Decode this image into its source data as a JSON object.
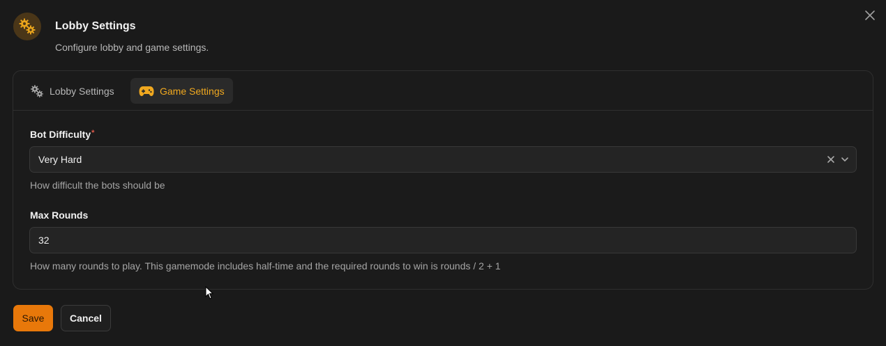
{
  "header": {
    "title": "Lobby Settings",
    "subtitle": "Configure lobby and game settings."
  },
  "tabs": [
    {
      "label": "Lobby Settings",
      "icon": "gears-icon",
      "active": false
    },
    {
      "label": "Game Settings",
      "icon": "gamepad-icon",
      "active": true
    }
  ],
  "fields": {
    "bot_difficulty": {
      "label": "Bot Difficulty",
      "required_marker": "*",
      "value": "Very Hard",
      "help": "How difficult the bots should be"
    },
    "max_rounds": {
      "label": "Max Rounds",
      "value": "32",
      "help": "How many rounds to play. This gamemode includes half-time and the required rounds to win is rounds / 2 + 1"
    }
  },
  "buttons": {
    "save": "Save",
    "cancel": "Cancel"
  },
  "colors": {
    "accent": "#f0a81f",
    "save_bg": "#e8780a",
    "required": "#e05a4a",
    "background": "#1a1a1a"
  }
}
